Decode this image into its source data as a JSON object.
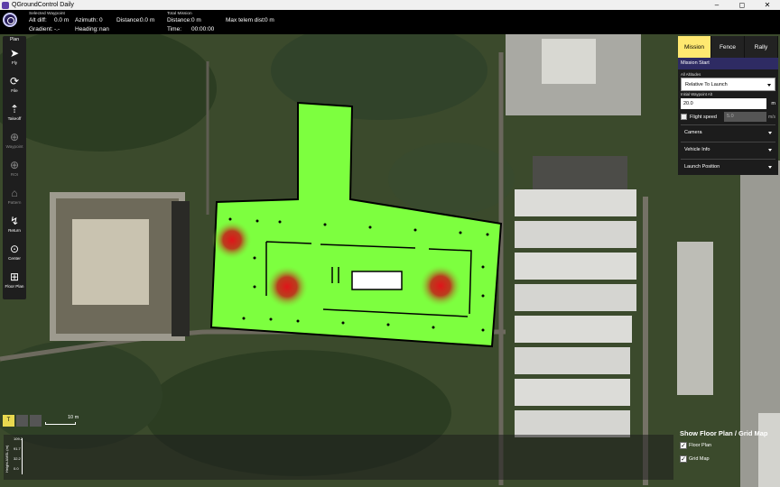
{
  "window": {
    "title": "QGroundControl Daily",
    "minimize": "–",
    "maximize": "◻",
    "close": "✕"
  },
  "toolbar": {
    "selected_waypoint_header": "Selected Waypoint",
    "total_mission_header": "Total Mission",
    "alt_diff": "Alt diff:",
    "alt_diff_val": "0.0 m",
    "azimuth": "Azimuth:",
    "azimuth_val": "0",
    "distance": "Distance:",
    "distance_val": "0.0 m",
    "gradient": "Gradient:",
    "gradient_val": "-.-",
    "heading": "Heading:",
    "heading_val": "nan",
    "total_distance": "Distance:",
    "total_distance_val": "0 m",
    "time": "Time:",
    "time_val": "00:00:00",
    "max_telem": "Max telem dist:",
    "max_telem_val": "0 m"
  },
  "toolstrip": {
    "header": "Plan",
    "tools": [
      {
        "name": "fly",
        "label": "Fly",
        "icon": "paper-plane-icon",
        "glyph": "➤",
        "dim": false
      },
      {
        "name": "file",
        "label": "File",
        "icon": "sync-icon",
        "glyph": "⟳",
        "dim": false
      },
      {
        "name": "takeoff",
        "label": "Takeoff",
        "icon": "takeoff-icon",
        "glyph": "⇡",
        "dim": false
      },
      {
        "name": "waypoint",
        "label": "Waypoint",
        "icon": "plus-circle-icon",
        "glyph": "⊕",
        "dim": true
      },
      {
        "name": "roi",
        "label": "ROI",
        "icon": "roi-icon",
        "glyph": "⊕",
        "dim": true
      },
      {
        "name": "pattern",
        "label": "Pattern",
        "icon": "pattern-icon",
        "glyph": "⌂",
        "dim": true
      },
      {
        "name": "return",
        "label": "Return",
        "icon": "return-icon",
        "glyph": "↯",
        "dim": false
      },
      {
        "name": "center",
        "label": "Center",
        "icon": "crosshair-icon",
        "glyph": "⊙",
        "dim": false
      },
      {
        "name": "floor-plan",
        "label": "Floor Plan",
        "icon": "floor-plan-icon",
        "glyph": "⊞",
        "dim": false
      }
    ]
  },
  "mission_panel": {
    "tabs": [
      "Mission",
      "Fence",
      "Rally"
    ],
    "active_tab": "Mission",
    "mission_start": "Mission Start",
    "all_altitudes": "All Altitudes",
    "altitude_mode": "Relative To Launch",
    "initial_wp_alt_label": "Initial Waypoint Alt",
    "initial_wp_alt": "20.0",
    "alt_unit": "m",
    "flight_speed_label": "Flight speed",
    "flight_speed": "5.0",
    "speed_unit": "m/s",
    "sections": [
      "Camera",
      "Vehicle Info",
      "Launch Position"
    ]
  },
  "map_controls": {
    "terrain_btn": "T",
    "scale": "10 m"
  },
  "altitude_graph": {
    "axis_title": "Height AMSL (m)",
    "ticks": [
      "109.2",
      "91.7",
      "32.2",
      "0.0"
    ]
  },
  "floor_plan": {
    "title": "Show Floor Plan / Grid Map",
    "options": [
      {
        "label": "Floor Plan",
        "checked": true
      },
      {
        "label": "Grid Map",
        "checked": true
      }
    ]
  },
  "colors": {
    "floor_green": "#7dff3f",
    "hotspot": "#e0141a",
    "accent": "#ffe870",
    "panel_header": "#2e2b63"
  }
}
